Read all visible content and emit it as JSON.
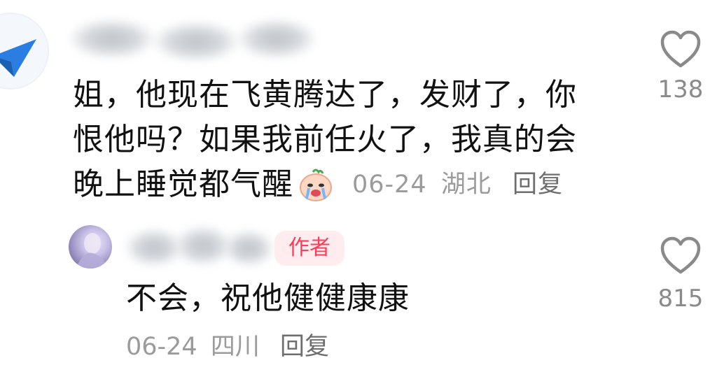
{
  "comments": [
    {
      "text_lines": [
        "姐，他现在飞黄腾达了，发财了，你",
        "恨他吗？如果我前任火了，我真的会",
        "晚上睡觉都气醒"
      ],
      "emoji": "crying-face-emoji",
      "date": "06-24",
      "location": "湖北",
      "reply_label": "回复",
      "likes": "138"
    },
    {
      "badge": "作者",
      "text": "不会，祝他健健康康",
      "date": "06-24",
      "location": "四川",
      "reply_label": "回复",
      "likes": "815"
    }
  ]
}
